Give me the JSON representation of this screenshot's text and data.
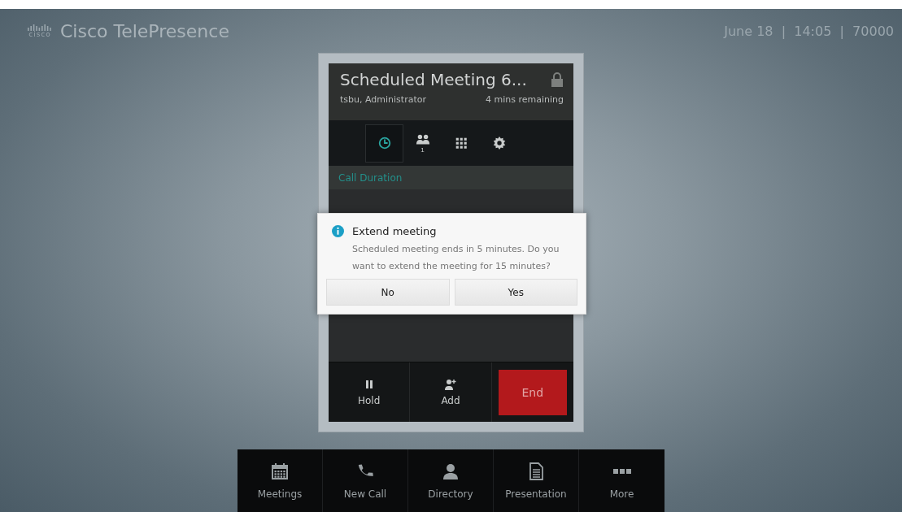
{
  "header": {
    "brand_mark": "cisco",
    "title": "Cisco TelePresence",
    "status": "June 18  |  14:05  |  70000"
  },
  "call": {
    "title": "Scheduled Meeting 6...",
    "locked": true,
    "participant": "tsbu, Administrator",
    "remaining": "4 mins remaining",
    "tabs": [
      {
        "selected": true
      },
      {
        "selected": false,
        "badge": "1"
      },
      {
        "selected": false
      },
      {
        "selected": false
      }
    ],
    "section": "Call Duration",
    "actions": [
      {
        "label": "Hold",
        "kind": "hold"
      },
      {
        "label": "Add",
        "kind": "add"
      },
      {
        "label": "End",
        "kind": "end"
      }
    ]
  },
  "dialog": {
    "title": "Extend meeting",
    "message": "Scheduled meeting ends in 5 minutes. Do you want to extend the meeting for 15 minutes?",
    "buttons": [
      "No",
      "Yes"
    ]
  },
  "dock": [
    {
      "label": "Meetings"
    },
    {
      "label": "New Call"
    },
    {
      "label": "Directory"
    },
    {
      "label": "Presentation"
    },
    {
      "label": "More"
    }
  ]
}
